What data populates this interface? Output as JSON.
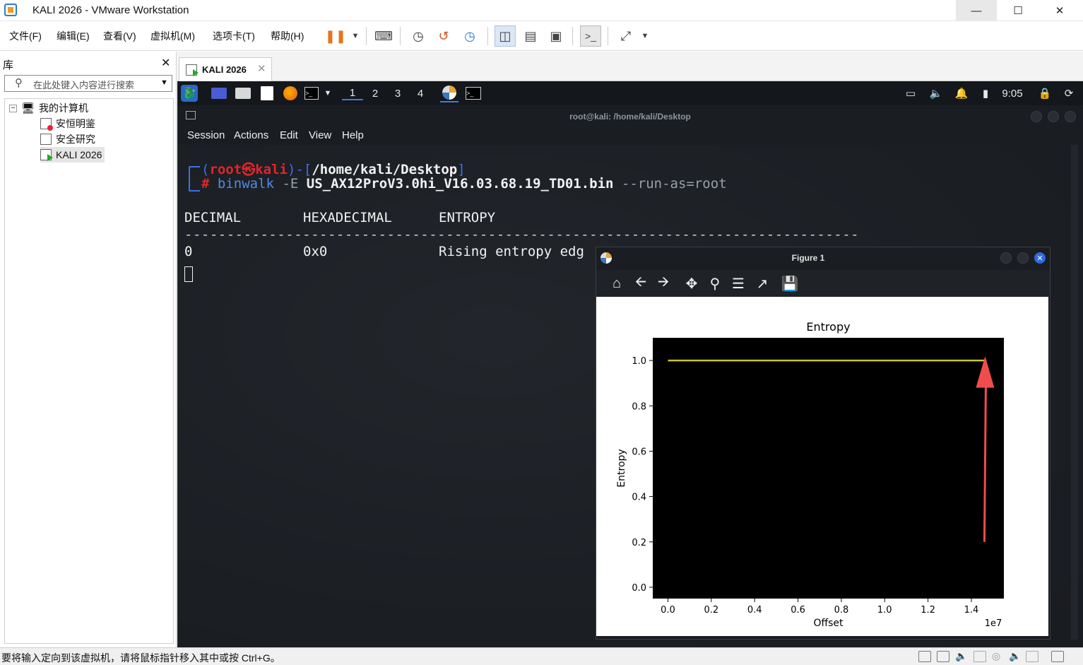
{
  "window": {
    "title": "KALI 2026 - VMware Workstation"
  },
  "menu": [
    "文件(F)",
    "编辑(E)",
    "查看(V)",
    "虚拟机(M)",
    "选项卡(T)",
    "帮助(H)"
  ],
  "library": {
    "title": "库",
    "search_placeholder": "在此处键入内容进行搜索",
    "root": "我的计算机",
    "items": [
      "安恒明鉴",
      "安全研究",
      "KALI 2026"
    ]
  },
  "vm_tab": {
    "label": "KALI 2026"
  },
  "guest_panel": {
    "workspaces": [
      "1",
      "2",
      "3",
      "4"
    ],
    "clock": "9:05"
  },
  "terminal": {
    "title": "root@kali: /home/kali/Desktop",
    "menu": [
      "Session",
      "Actions",
      "Edit",
      "View",
      "Help"
    ],
    "prompt_user": "root",
    "prompt_at": "㉿",
    "prompt_host": "kali",
    "prompt_path": "/home/kali/Desktop",
    "prompt_hash": "#",
    "cmd_name": "binwalk",
    "cmd_flag": "-E",
    "cmd_file": "US_AX12ProV3.0hi_V16.03.68.19_TD01.bin",
    "cmd_opt": "--run-as=root",
    "headers": [
      "DECIMAL",
      "HEXADECIMAL",
      "ENTROPY"
    ],
    "rule": "--------------------------------------------------------------------------------",
    "row": [
      "0",
      "0x0",
      "Rising entropy edg"
    ]
  },
  "figure": {
    "title": "Figure 1"
  },
  "chart_data": {
    "type": "line",
    "title": "Entropy",
    "xlabel": "Offset",
    "ylabel": "Entropy",
    "x_offset_text": "1e7",
    "x_ticks": [
      "0.0",
      "0.2",
      "0.4",
      "0.6",
      "0.8",
      "1.0",
      "1.2",
      "1.4"
    ],
    "y_ticks": [
      "0.0",
      "0.2",
      "0.4",
      "0.6",
      "0.8",
      "1.0"
    ],
    "xlim": [
      -0.07,
      1.55
    ],
    "ylim": [
      -0.05,
      1.1
    ],
    "background": "#000000",
    "line_color": "#c8c23a",
    "series": [
      {
        "x": [
          0.0,
          0.2,
          0.4,
          0.6,
          0.8,
          1.0,
          1.2,
          1.47
        ],
        "values": [
          1.0,
          1.0,
          1.0,
          1.0,
          1.0,
          1.0,
          1.0,
          1.0
        ]
      }
    ]
  },
  "status_bar": {
    "text": "要将输入定向到该虚拟机，请将鼠标指针移入其中或按 Ctrl+G。"
  },
  "colors": {
    "accent": "#3d7ce5",
    "prompt_red": "#e0262a",
    "prompt_blue": "#3a72e6",
    "cmd_blue": "#4d8ce6",
    "annotation_arrow": "#ef4c4c"
  }
}
